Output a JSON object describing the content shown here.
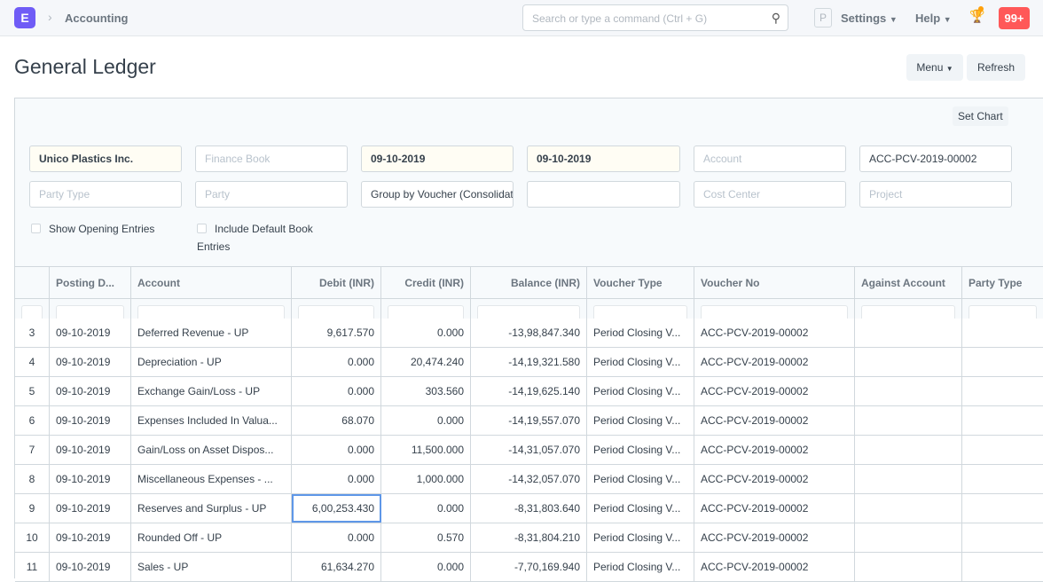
{
  "navbar": {
    "logo": "E",
    "breadcrumb": "Accounting",
    "search_placeholder": "Search or type a command (Ctrl + G)",
    "avatar_letter": "P",
    "settings": "Settings",
    "help": "Help",
    "notifications": "99+"
  },
  "page": {
    "title": "General Ledger",
    "menu": "Menu",
    "refresh": "Refresh",
    "set_chart": "Set Chart"
  },
  "filters": {
    "company": "Unico Plastics Inc.",
    "finance_book": "Finance Book",
    "from_date": "09-10-2019",
    "to_date": "09-10-2019",
    "account": "Account",
    "voucher_no": "ACC-PCV-2019-00002",
    "party_type": "Party Type",
    "party": "Party",
    "group_by": "Group by Voucher (Consolidated)",
    "blank": "",
    "cost_center": "Cost Center",
    "project": "Project",
    "show_opening": "Show Opening Entries",
    "include_default_book": "Include Default Book",
    "include_default_book_2": "Entries"
  },
  "columns": [
    "",
    "Posting D...",
    "Account",
    "Debit (INR)",
    "Credit (INR)",
    "Balance (INR)",
    "Voucher Type",
    "Voucher No",
    "Against Account",
    "Party Type"
  ],
  "rows": [
    {
      "n": "3",
      "date": "09-10-2019",
      "account": "Deferred Revenue - UP",
      "debit": "9,617.570",
      "credit": "0.000",
      "balance": "-13,98,847.340",
      "vtype": "Period Closing V...",
      "vno": "ACC-PCV-2019-00002"
    },
    {
      "n": "4",
      "date": "09-10-2019",
      "account": "Depreciation - UP",
      "debit": "0.000",
      "credit": "20,474.240",
      "balance": "-14,19,321.580",
      "vtype": "Period Closing V...",
      "vno": "ACC-PCV-2019-00002"
    },
    {
      "n": "5",
      "date": "09-10-2019",
      "account": "Exchange Gain/Loss - UP",
      "debit": "0.000",
      "credit": "303.560",
      "balance": "-14,19,625.140",
      "vtype": "Period Closing V...",
      "vno": "ACC-PCV-2019-00002"
    },
    {
      "n": "6",
      "date": "09-10-2019",
      "account": "Expenses Included In Valua...",
      "debit": "68.070",
      "credit": "0.000",
      "balance": "-14,19,557.070",
      "vtype": "Period Closing V...",
      "vno": "ACC-PCV-2019-00002"
    },
    {
      "n": "7",
      "date": "09-10-2019",
      "account": "Gain/Loss on Asset Dispos...",
      "debit": "0.000",
      "credit": "11,500.000",
      "balance": "-14,31,057.070",
      "vtype": "Period Closing V...",
      "vno": "ACC-PCV-2019-00002"
    },
    {
      "n": "8",
      "date": "09-10-2019",
      "account": "Miscellaneous Expenses - ...",
      "debit": "0.000",
      "credit": "1,000.000",
      "balance": "-14,32,057.070",
      "vtype": "Period Closing V...",
      "vno": "ACC-PCV-2019-00002"
    },
    {
      "n": "9",
      "date": "09-10-2019",
      "account": "Reserves and Surplus - UP",
      "debit": "6,00,253.430",
      "credit": "0.000",
      "balance": "-8,31,803.640",
      "vtype": "Period Closing V...",
      "vno": "ACC-PCV-2019-00002"
    },
    {
      "n": "10",
      "date": "09-10-2019",
      "account": "Rounded Off - UP",
      "debit": "0.000",
      "credit": "0.570",
      "balance": "-8,31,804.210",
      "vtype": "Period Closing V...",
      "vno": "ACC-PCV-2019-00002"
    },
    {
      "n": "11",
      "date": "09-10-2019",
      "account": "Sales - UP",
      "debit": "61,634.270",
      "credit": "0.000",
      "balance": "-7,70,169.940",
      "vtype": "Period Closing V...",
      "vno": "ACC-PCV-2019-00002"
    }
  ]
}
